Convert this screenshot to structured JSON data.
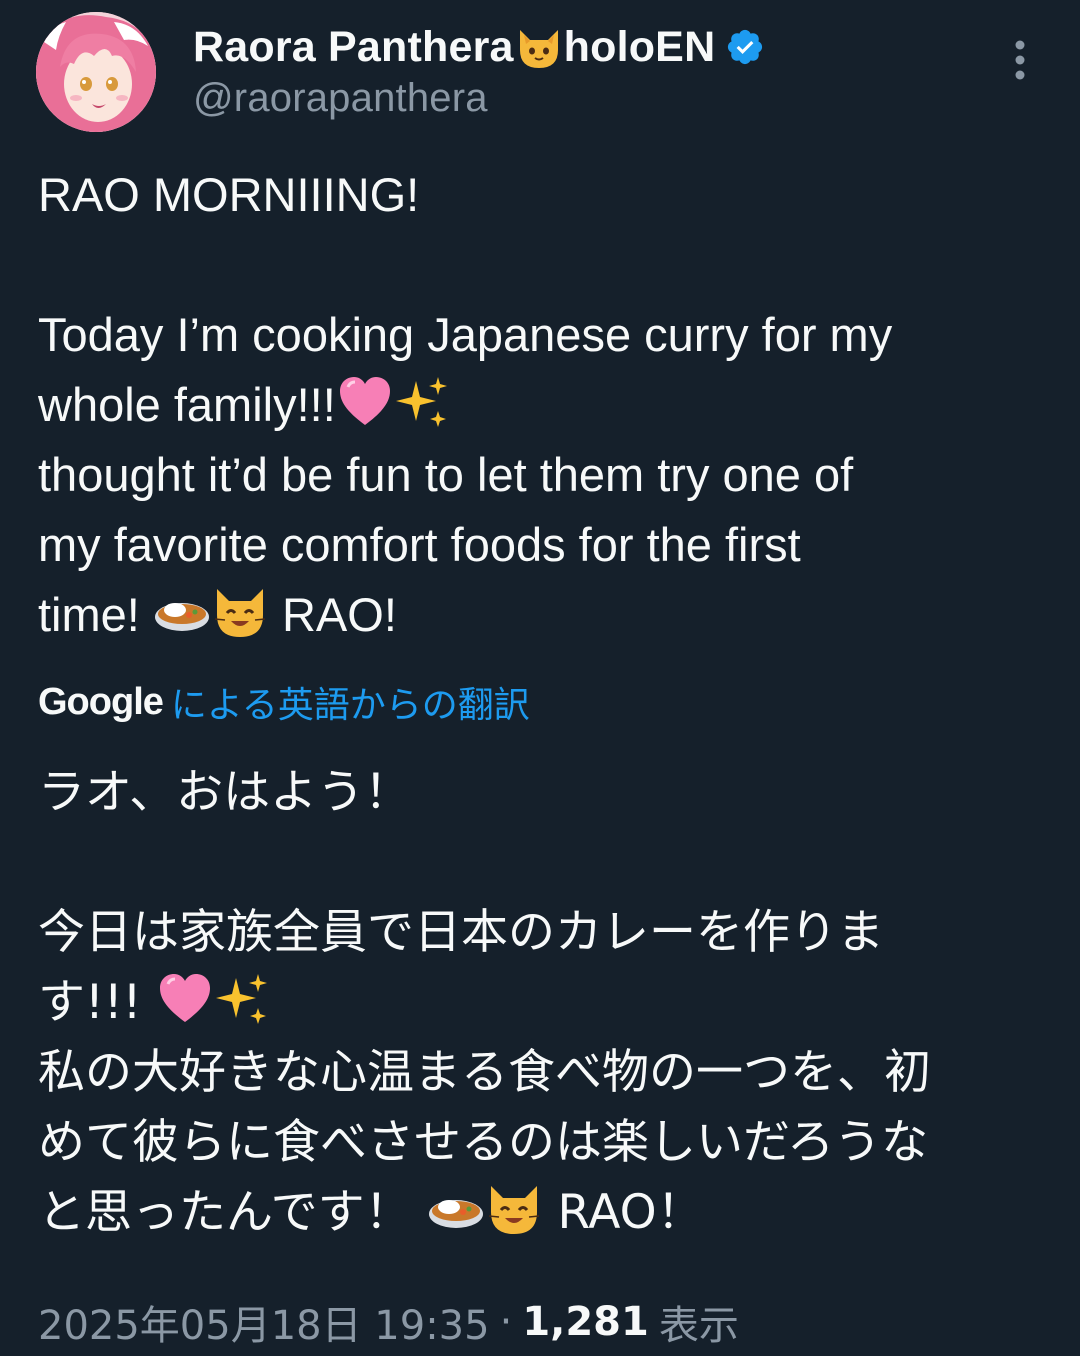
{
  "author": {
    "display_name_prefix": "Raora Panthera",
    "display_name_suffix": "holoEN",
    "name_emoji_icon": "cat-face-icon",
    "verified_icon": "verified-badge-icon",
    "verified_color": "#1d9bf0",
    "handle": "@raorapanthera",
    "avatar_icon": "avatar-pink-hair-character"
  },
  "menu": {
    "icon": "more-vertical-icon"
  },
  "tweet": {
    "line1": "RAO MORNIIING!",
    "line2": "Today I’m cooking Japanese curry for my",
    "line3": "whole family!!!",
    "line4": "thought it’d be fun to let them try one of",
    "line5": "my favorite comfort foods for the first",
    "line6a": "time! ",
    "line6b": " RAO!",
    "emojis": {
      "heart": "pink-heart-icon",
      "sparkles": "sparkles-icon",
      "curry": "curry-rice-icon",
      "cat": "smiling-cat-icon"
    }
  },
  "translation_label": {
    "google": "Google",
    "link": "による英語からの翻訳",
    "link_color": "#1d9bf0"
  },
  "translation": {
    "line1": "ラオ、おはよう！",
    "line2": "今日は家族全員で日本のカレーを作りま",
    "line3": "す!!! ",
    "line4": "私の大好きな心温まる食べ物の一つを、初",
    "line5": "めて彼らに食べさせるのは楽しいだろうな",
    "line6a": "と思ったんです！ ",
    "line6b": " RAO！"
  },
  "meta": {
    "timestamp": "2025年05月18日 19:35",
    "separator": "·",
    "views_count": "1,281",
    "views_label": "表示"
  },
  "colors": {
    "background": "#15202b",
    "text": "#f7f9f9",
    "secondary_text": "#8b98a5"
  }
}
